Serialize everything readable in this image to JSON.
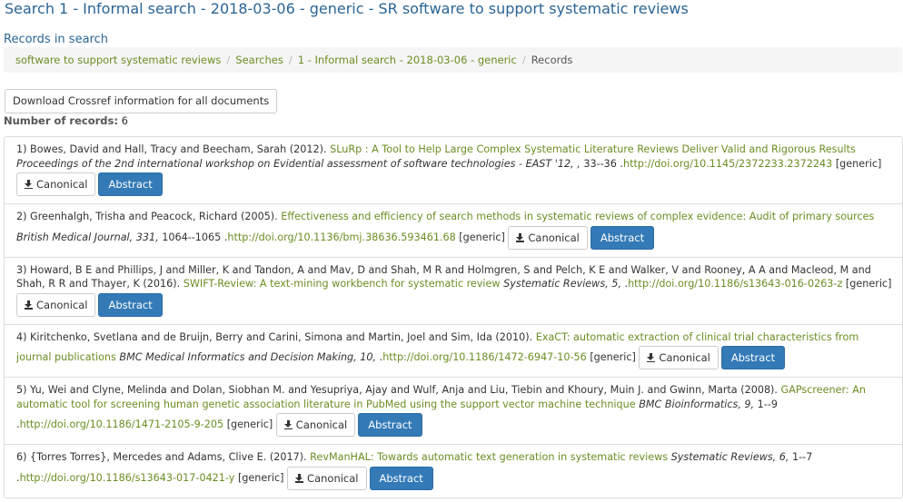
{
  "page": {
    "title": "Search 1 - Informal search - 2018-03-06 - generic - SR software to support systematic reviews",
    "subtitle": "Records in search"
  },
  "breadcrumb": [
    {
      "label": "software to support systematic reviews"
    },
    {
      "label": "Searches"
    },
    {
      "label": "1 - Informal search - 2018-03-06 - generic"
    },
    {
      "label": "Records"
    }
  ],
  "download_label": "Download Crossref information for all documents",
  "count": {
    "label": "Number of records:",
    "value": "6"
  },
  "buttons": {
    "canonical": "Canonical",
    "abstract": "Abstract"
  },
  "records": [
    {
      "authors": "1) Bowes, David and Hall, Tracy and Beecham, Sarah (2012).",
      "title": "SLuRp : A Tool to Help Large Complex Systematic Literature Reviews Deliver Valid and Rigorous Results",
      "venue": "Proceedings of the 2nd international workshop on Evidential assessment of software technologies - EAST '12, ,",
      "pages": "33--36 .",
      "doi": "http://doi.org/10.1145/2372233.2372243",
      "tag": "[generic]"
    },
    {
      "authors": "2) Greenhalgh, Trisha and Peacock, Richard (2005).",
      "title": "Effectiveness and efficiency of search methods in systematic reviews of complex evidence: Audit of primary sources",
      "venue": "British Medical Journal, 331,",
      "pages": "1064--1065 .",
      "doi": "http://doi.org/10.1136/bmj.38636.593461.68",
      "tag": "[generic]"
    },
    {
      "authors": "3) Howard, B E and Phillips, J and Miller, K and Tandon, A and Mav, D and Shah, M R and Holmgren, S and Pelch, K E and Walker, V and Rooney, A A and Macleod, M and Shah, R R and Thayer, K (2016).",
      "title": "SWIFT-Review: A text-mining workbench for systematic review",
      "venue": "Systematic Reviews, 5,",
      "pages": ".",
      "doi": "http://doi.org/10.1186/s13643-016-0263-z",
      "tag": "[generic]"
    },
    {
      "authors": "4) Kiritchenko, Svetlana and de Bruijn, Berry and Carini, Simona and Martin, Joel and Sim, Ida (2010).",
      "title": "ExaCT: automatic extraction of clinical trial characteristics from journal publications",
      "venue": "BMC Medical Informatics and Decision Making, 10,",
      "pages": ".",
      "doi": "http://doi.org/10.1186/1472-6947-10-56",
      "tag": "[generic]"
    },
    {
      "authors": "5) Yu, Wei and Clyne, Melinda and Dolan, Siobhan M. and Yesupriya, Ajay and Wulf, Anja and Liu, Tiebin and Khoury, Muin J. and Gwinn, Marta (2008).",
      "title": "GAPscreener: An automatic tool for screening human genetic association literature in PubMed using the support vector machine technique",
      "venue": "BMC Bioinformatics, 9,",
      "pages": "1--9 .",
      "doi": "http://doi.org/10.1186/1471-2105-9-205",
      "tag": "[generic]"
    },
    {
      "authors": "6) {Torres Torres}, Mercedes and Adams, Clive E. (2017).",
      "title": "RevManHAL: Towards automatic text generation in systematic reviews",
      "venue": "Systematic Reviews, 6,",
      "pages": "1--7 .",
      "doi": "http://doi.org/10.1186/s13643-017-0421-y",
      "tag": "[generic]"
    }
  ]
}
